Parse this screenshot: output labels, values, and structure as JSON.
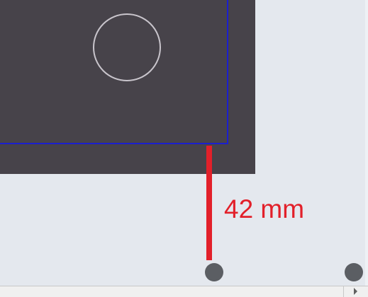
{
  "canvas": {
    "background_color": "#e4e8ee"
  },
  "part": {
    "panel_color": "#47434a",
    "outline_color": "#1b1fcf",
    "circle_color": "#c9c5cc"
  },
  "dimension": {
    "label": "42 mm",
    "color": "#e2202a"
  },
  "handles": {
    "color": "#5b5e63"
  },
  "scrollbar": {
    "right_arrow_icon": "triangle-right-icon"
  }
}
